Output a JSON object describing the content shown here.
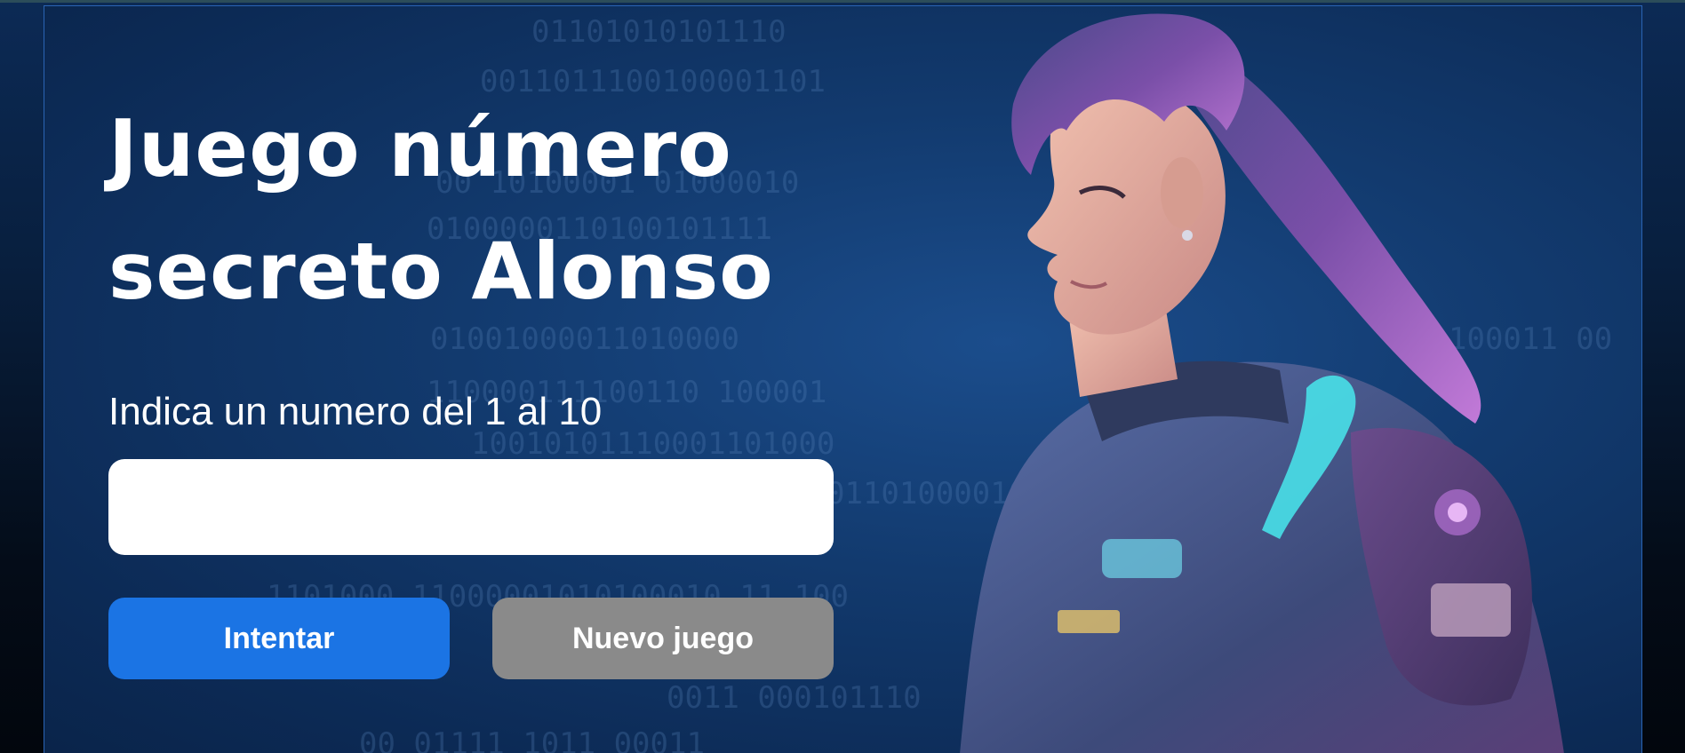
{
  "game": {
    "title": "Juego número secreto Alonso",
    "prompt": "Indica un numero del 1 al 10",
    "input_value": "",
    "try_button": "Intentar",
    "new_game_button": "Nuevo juego"
  },
  "colors": {
    "page_background": "#081f3e",
    "panel_background": "#123a6e",
    "panel_border": "#2a64b4",
    "primary_button": "#1b74e4",
    "secondary_button": "#8a8a8a",
    "text": "#ffffff"
  },
  "background_art": {
    "binary_rain": [
      "01101010101110",
      "0011011100100001101",
      "00 10100001 01000010",
      "0100000110100101111",
      "01001000011010000",
      "110000111100110 100001",
      "10010101110001101000",
      "011010000101",
      "1101000 11000001010100010 11 100",
      "00 01111 1011 00011",
      "0011 000101110",
      "100011 00"
    ],
    "illustration": "woman-astronaut-profile"
  }
}
